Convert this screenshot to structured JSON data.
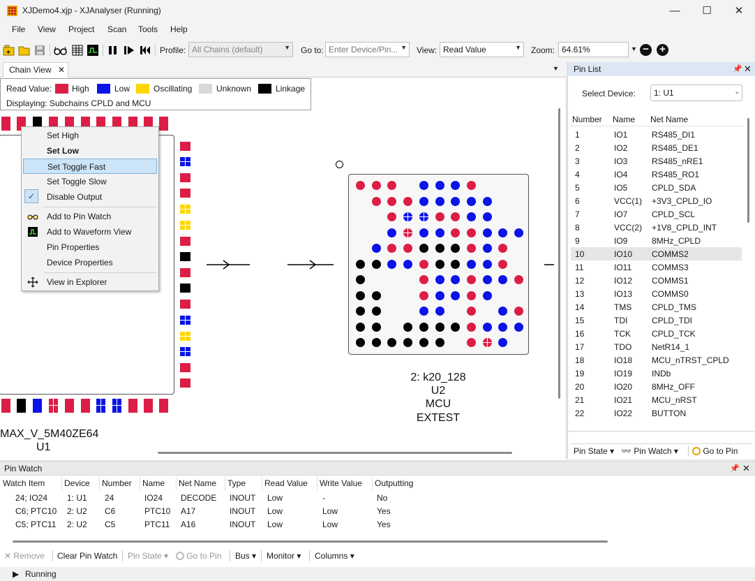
{
  "window": {
    "title": "XJDemo4.xjp - XJAnalyser (Running)",
    "controls": {
      "minimize": "—",
      "maximize": "☐",
      "close": "✕"
    }
  },
  "menu": [
    "File",
    "View",
    "Project",
    "Scan",
    "Tools",
    "Help"
  ],
  "toolbar": {
    "profile_label": "Profile:",
    "profile_value": "All Chains (default)",
    "goto_label": "Go to:",
    "goto_placeholder": "Enter Device/Pin...",
    "view_label": "View:",
    "view_value": "Read Value",
    "zoom_label": "Zoom:",
    "zoom_value": "64.61%",
    "zoom_out": "−",
    "zoom_in": "+"
  },
  "chain_view": {
    "tab_label": "Chain View",
    "legend": {
      "read_value_label": "Read Value:",
      "items": [
        {
          "label": "High",
          "color": "#dc1e46"
        },
        {
          "label": "Low",
          "color": "#0a14e6"
        },
        {
          "label": "Oscillating",
          "color": "#ffd700"
        },
        {
          "label": "Unknown",
          "color": "#d9d9d9"
        },
        {
          "label": "Linkage",
          "color": "#000000"
        }
      ],
      "displaying": "Displaying: Subchains CPLD and MCU"
    },
    "device1": {
      "name": "MAX_V_5M40ZE64",
      "ref": "U1"
    },
    "device2": {
      "index_name": "2: k20_128",
      "ref": "U2",
      "role": "MCU",
      "mode": "EXTEST"
    }
  },
  "context_menu": {
    "items": [
      {
        "label": "Set High",
        "icon": ""
      },
      {
        "label": "Set Low",
        "icon": "",
        "bold": true
      },
      {
        "label": "Set Toggle Fast",
        "icon": "",
        "highlighted": true
      },
      {
        "label": "Set Toggle Slow",
        "icon": ""
      },
      {
        "label": "Disable Output",
        "icon": "check-icon"
      },
      {
        "label": "Add to Pin Watch",
        "icon": "glasses-icon"
      },
      {
        "label": "Add to Waveform View",
        "icon": "waveform-icon"
      },
      {
        "label": "Pin Properties",
        "icon": ""
      },
      {
        "label": "Device Properties",
        "icon": ""
      },
      {
        "label": "View in Explorer",
        "icon": "crosshair-icon"
      }
    ]
  },
  "pin_list": {
    "title": "Pin List",
    "select_device_label": "Select Device:",
    "select_device_value": "1: U1",
    "columns": [
      "Number",
      "Name",
      "Net Name"
    ],
    "rows": [
      [
        "1",
        "IO1",
        "RS485_DI1"
      ],
      [
        "2",
        "IO2",
        "RS485_DE1"
      ],
      [
        "3",
        "IO3",
        "RS485_nRE1"
      ],
      [
        "4",
        "IO4",
        "RS485_RO1"
      ],
      [
        "5",
        "IO5",
        "CPLD_SDA"
      ],
      [
        "6",
        "VCC(1)",
        "+3V3_CPLD_IO"
      ],
      [
        "7",
        "IO7",
        "CPLD_SCL"
      ],
      [
        "8",
        "VCC(2)",
        "+1V8_CPLD_INT"
      ],
      [
        "9",
        "IO9",
        "8MHz_CPLD"
      ],
      [
        "10",
        "IO10",
        "COMMS2"
      ],
      [
        "11",
        "IO11",
        "COMMS3"
      ],
      [
        "12",
        "IO12",
        "COMMS1"
      ],
      [
        "13",
        "IO13",
        "COMMS0"
      ],
      [
        "14",
        "TMS",
        "CPLD_TMS"
      ],
      [
        "15",
        "TDI",
        "CPLD_TDI"
      ],
      [
        "16",
        "TCK",
        "CPLD_TCK"
      ],
      [
        "17",
        "TDO",
        "NetR14_1"
      ],
      [
        "18",
        "IO18",
        "MCU_nTRST_CPLD"
      ],
      [
        "19",
        "IO19",
        "INDb"
      ],
      [
        "20",
        "IO20",
        "8MHz_OFF"
      ],
      [
        "21",
        "IO21",
        "MCU_nRST"
      ],
      [
        "22",
        "IO22",
        "BUTTON"
      ]
    ],
    "selected_row": "10",
    "footer": {
      "pin_state": "Pin State",
      "pin_watch": "Pin Watch",
      "go_to_pin": "Go to Pin"
    }
  },
  "pin_watch": {
    "title": "Pin Watch",
    "columns": [
      "Watch Item",
      "Device",
      "Number",
      "Name",
      "Net Name",
      "Type",
      "Read Value",
      "Write Value",
      "Outputting"
    ],
    "rows": [
      [
        "24; IO24",
        "1: U1",
        "24",
        "IO24",
        "DECODE",
        "INOUT",
        "Low",
        "-",
        "No"
      ],
      [
        "C6; PTC10",
        "2: U2",
        "C6",
        "PTC10",
        "A17",
        "INOUT",
        "Low",
        "Low",
        "Yes"
      ],
      [
        "C5; PTC11",
        "2: U2",
        "C5",
        "PTC11",
        "A16",
        "INOUT",
        "Low",
        "Low",
        "Yes"
      ]
    ],
    "toolbar": {
      "remove": "Remove",
      "clear": "Clear Pin Watch",
      "pin_state": "Pin State",
      "go_to_pin": "Go to Pin",
      "bus": "Bus",
      "monitor": "Monitor",
      "columns": "Columns"
    }
  },
  "status": {
    "text": "Running"
  }
}
